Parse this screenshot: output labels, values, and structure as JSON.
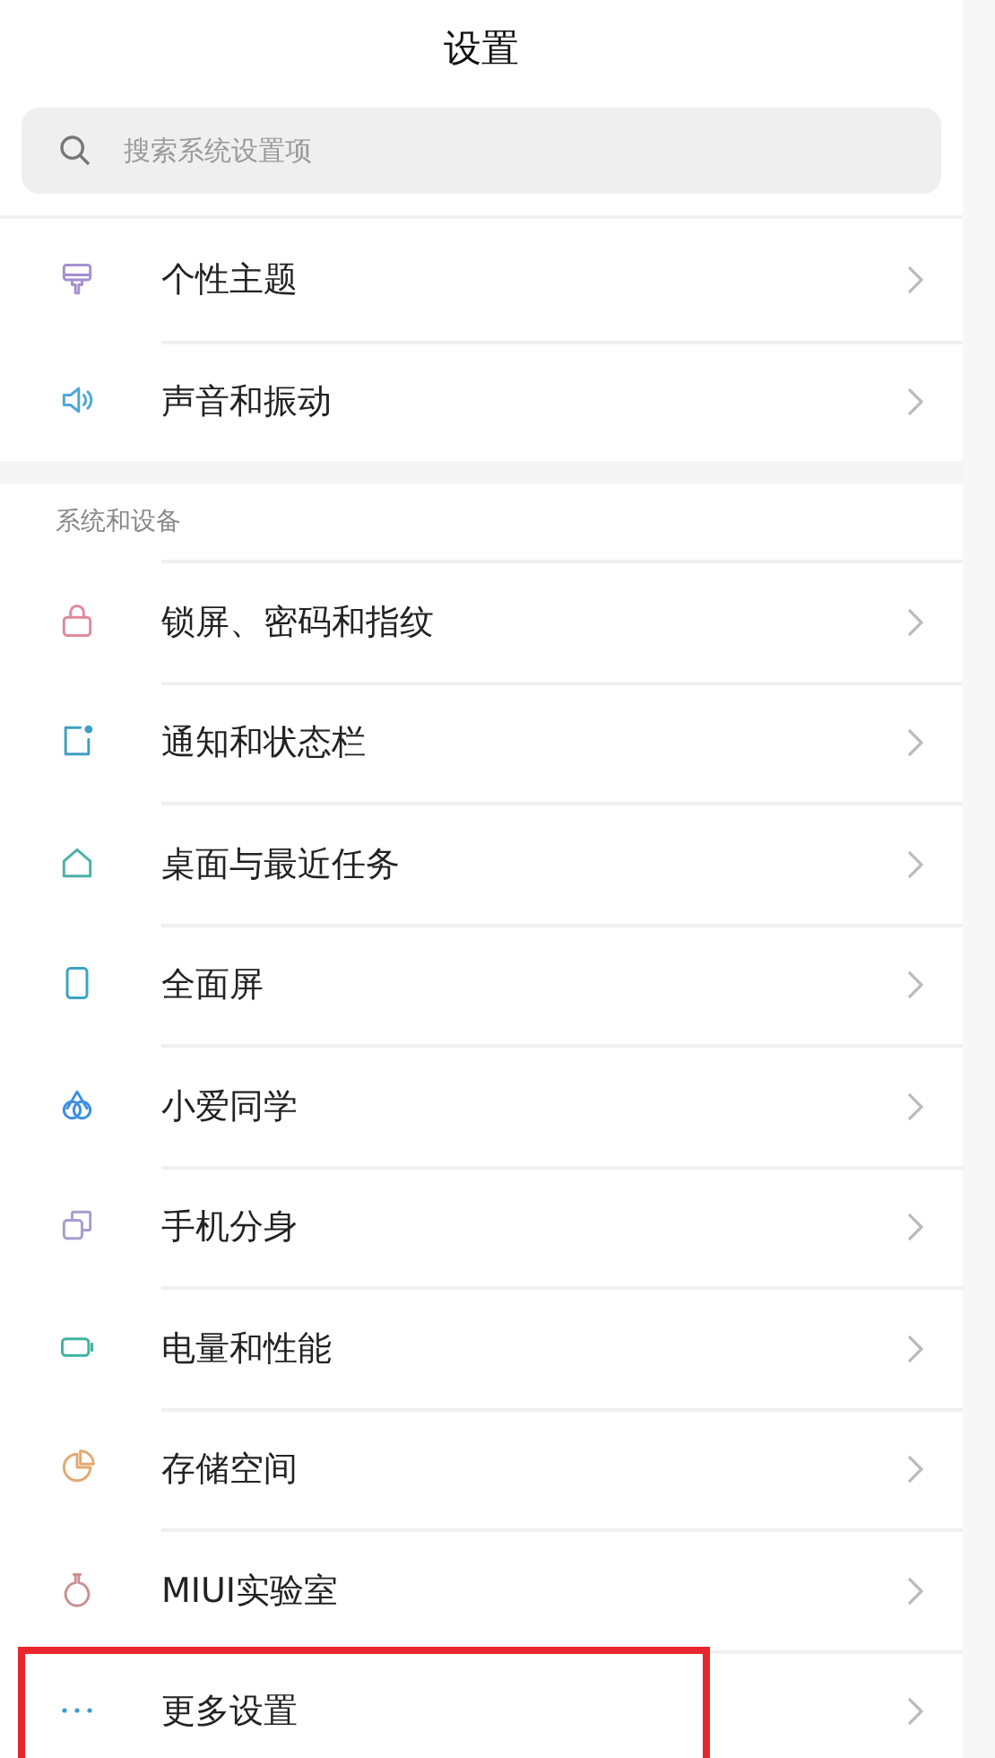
{
  "title": "设置",
  "search": {
    "placeholder": "搜索系统设置项"
  },
  "groups": [
    {
      "items": [
        {
          "label": "个性主题",
          "color": "#a58fd0",
          "highlighted": false
        },
        {
          "label": "声音和振动",
          "color": "#4aa8d8",
          "highlighted": false
        }
      ]
    },
    {
      "header": "系统和设备",
      "items": [
        {
          "label": "锁屏、密码和指纹",
          "color": "#e08a9a",
          "highlighted": false
        },
        {
          "label": "通知和状态栏",
          "color": "#3f9fc4",
          "highlighted": false
        },
        {
          "label": "桌面与最近任务",
          "color": "#4bb0a8",
          "highlighted": false
        },
        {
          "label": "全面屏",
          "color": "#3aa3c8",
          "highlighted": false
        },
        {
          "label": "小爱同学",
          "color": "#3d8fe0",
          "highlighted": false
        },
        {
          "label": "手机分身",
          "color": "#a79cd0",
          "highlighted": false
        },
        {
          "label": "电量和性能",
          "color": "#3fb2a0",
          "highlighted": false
        },
        {
          "label": "存储空间",
          "color": "#e5a870",
          "highlighted": false
        },
        {
          "label": "MIUI实验室",
          "color": "#c98f8f",
          "highlighted": false
        },
        {
          "label": "更多设置",
          "color": "#3a9fd0",
          "highlighted": true
        }
      ]
    }
  ]
}
